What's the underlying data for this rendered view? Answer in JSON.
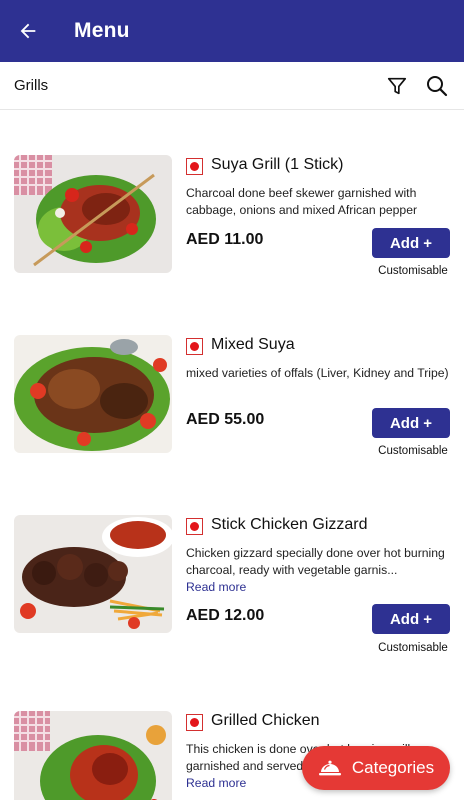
{
  "appbar": {
    "title": "Menu"
  },
  "subbar": {
    "title": "Grills"
  },
  "items": [
    {
      "name": "Suya Grill (1 Stick)",
      "description": "Charcoal done beef skewer garnished with cabbage, onions and mixed African pepper",
      "read_more": "",
      "price": "AED 11.00",
      "add_label": "Add +",
      "custom_label": "Customisable"
    },
    {
      "name": "Mixed Suya",
      "description": "mixed varieties of offals (Liver, Kidney and Tripe)",
      "read_more": "",
      "price": "AED 55.00",
      "add_label": "Add +",
      "custom_label": "Customisable"
    },
    {
      "name": "Stick Chicken Gizzard",
      "description": "Chicken gizzard specially done over hot burning charcoal, ready with vegetable garnis...",
      "read_more": "Read more",
      "price": "AED 12.00",
      "add_label": "Add +",
      "custom_label": "Customisable"
    },
    {
      "name": "Grilled Chicken",
      "description": "This chicken is done over hot burning grill, garnished and served...",
      "read_more": "Read more",
      "price": "",
      "add_label": "",
      "custom_label": ""
    }
  ],
  "fab": {
    "label": "Categories"
  },
  "colors": {
    "primary": "#2e3192",
    "accent": "#e53935",
    "veg_dot": "#e3161b"
  }
}
